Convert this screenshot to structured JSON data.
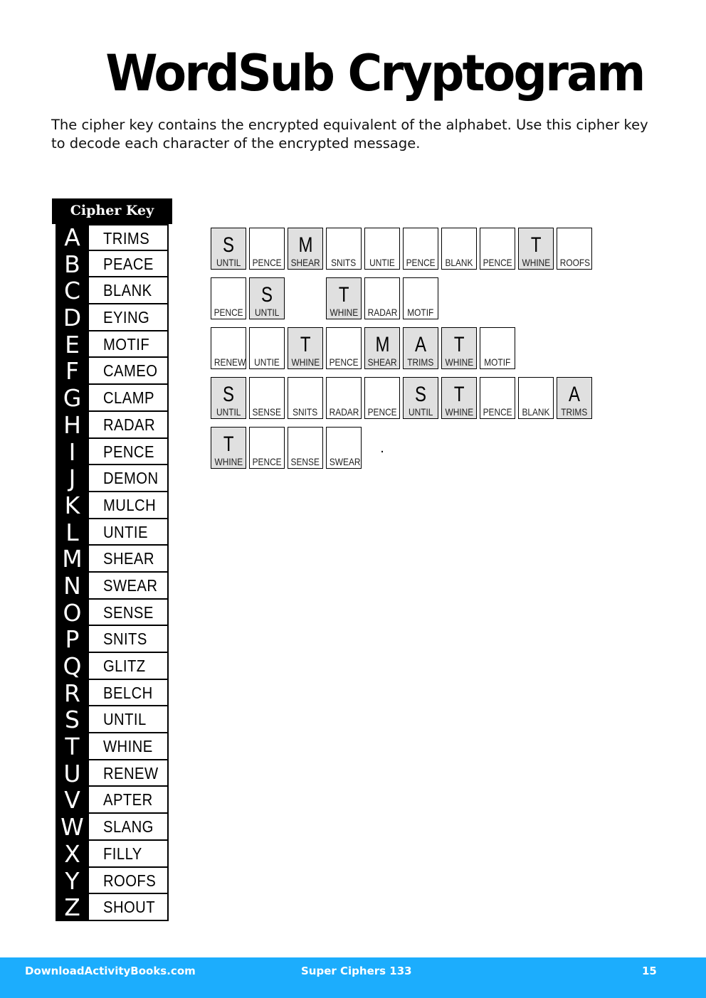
{
  "title": "WordSub Cryptogram",
  "instructions": "The cipher key contains the encrypted equivalent of the alphabet. Use this cipher key to decode each character of the encrypted message.",
  "cipher_key": {
    "header": "Cipher Key",
    "rows": [
      {
        "letter": "A",
        "word": "TRIMS"
      },
      {
        "letter": "B",
        "word": "PEACE"
      },
      {
        "letter": "C",
        "word": "BLANK"
      },
      {
        "letter": "D",
        "word": "EYING"
      },
      {
        "letter": "E",
        "word": "MOTIF"
      },
      {
        "letter": "F",
        "word": "CAMEO"
      },
      {
        "letter": "G",
        "word": "CLAMP"
      },
      {
        "letter": "H",
        "word": "RADAR"
      },
      {
        "letter": "I",
        "word": "PENCE"
      },
      {
        "letter": "J",
        "word": "DEMON"
      },
      {
        "letter": "K",
        "word": "MULCH"
      },
      {
        "letter": "L",
        "word": "UNTIE"
      },
      {
        "letter": "M",
        "word": "SHEAR"
      },
      {
        "letter": "N",
        "word": "SWEAR"
      },
      {
        "letter": "O",
        "word": "SENSE"
      },
      {
        "letter": "P",
        "word": "SNITS"
      },
      {
        "letter": "Q",
        "word": "GLITZ"
      },
      {
        "letter": "R",
        "word": "BELCH"
      },
      {
        "letter": "S",
        "word": "UNTIL"
      },
      {
        "letter": "T",
        "word": "WHINE"
      },
      {
        "letter": "U",
        "word": "RENEW"
      },
      {
        "letter": "V",
        "word": "APTER"
      },
      {
        "letter": "W",
        "word": "SLANG"
      },
      {
        "letter": "X",
        "word": "FILLY"
      },
      {
        "letter": "Y",
        "word": "ROOFS"
      },
      {
        "letter": "Z",
        "word": "SHOUT"
      }
    ]
  },
  "puzzle": {
    "rows": [
      [
        {
          "code": "UNTIL",
          "answer": "S"
        },
        {
          "code": "PENCE",
          "answer": ""
        },
        {
          "code": "SHEAR",
          "answer": "M"
        },
        {
          "code": "SNITS",
          "answer": ""
        },
        {
          "code": "UNTIE",
          "answer": ""
        },
        {
          "code": "PENCE",
          "answer": ""
        },
        {
          "code": "BLANK",
          "answer": ""
        },
        {
          "code": "PENCE",
          "answer": ""
        },
        {
          "code": "WHINE",
          "answer": "T"
        },
        {
          "code": "ROOFS",
          "answer": ""
        }
      ],
      [
        {
          "code": "PENCE",
          "answer": ""
        },
        {
          "code": "UNTIL",
          "answer": "S"
        },
        {
          "type": "space"
        },
        {
          "code": "WHINE",
          "answer": "T"
        },
        {
          "code": "RADAR",
          "answer": ""
        },
        {
          "code": "MOTIF",
          "answer": ""
        }
      ],
      [
        {
          "code": "RENEW",
          "answer": ""
        },
        {
          "code": "UNTIE",
          "answer": ""
        },
        {
          "code": "WHINE",
          "answer": "T"
        },
        {
          "code": "PENCE",
          "answer": ""
        },
        {
          "code": "SHEAR",
          "answer": "M"
        },
        {
          "code": "TRIMS",
          "answer": "A"
        },
        {
          "code": "WHINE",
          "answer": "T"
        },
        {
          "code": "MOTIF",
          "answer": ""
        }
      ],
      [
        {
          "code": "UNTIL",
          "answer": "S"
        },
        {
          "code": "SENSE",
          "answer": ""
        },
        {
          "code": "SNITS",
          "answer": ""
        },
        {
          "code": "RADAR",
          "answer": ""
        },
        {
          "code": "PENCE",
          "answer": ""
        },
        {
          "code": "UNTIL",
          "answer": "S"
        },
        {
          "code": "WHINE",
          "answer": "T"
        },
        {
          "code": "PENCE",
          "answer": ""
        },
        {
          "code": "BLANK",
          "answer": ""
        },
        {
          "code": "TRIMS",
          "answer": "A"
        }
      ],
      [
        {
          "code": "WHINE",
          "answer": "T"
        },
        {
          "code": "PENCE",
          "answer": ""
        },
        {
          "code": "SENSE",
          "answer": ""
        },
        {
          "code": "SWEAR",
          "answer": ""
        },
        {
          "type": "punct",
          "answer": "."
        }
      ]
    ]
  },
  "footer": {
    "site": "DownloadActivityBooks.com",
    "book": "Super Ciphers 133",
    "page": "15"
  }
}
